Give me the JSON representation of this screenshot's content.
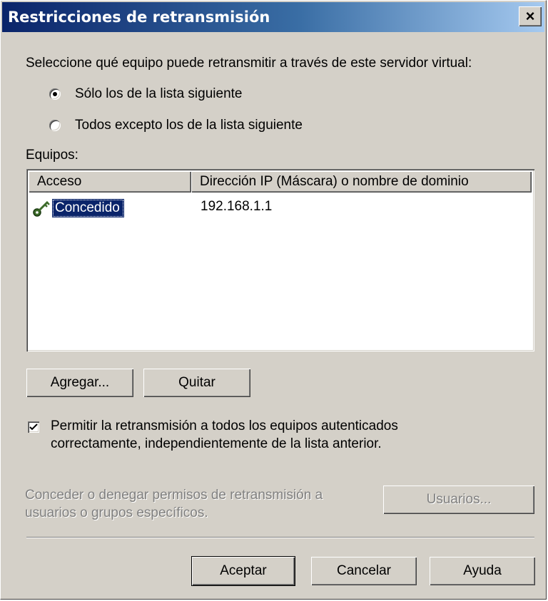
{
  "window": {
    "title": "Restricciones de retransmisión",
    "close_label": "×"
  },
  "intro_text": "Seleccione qué equipo puede retransmitir a través de este servidor virtual:",
  "radio_options": [
    {
      "label": "Sólo los de la lista siguiente",
      "selected": true
    },
    {
      "label": "Todos excepto los de la lista siguiente",
      "selected": false
    }
  ],
  "equipos_label": "Equipos:",
  "table": {
    "columns": [
      "Acceso",
      "Dirección IP (Máscara) o nombre de dominio"
    ],
    "rows": [
      {
        "access": "Concedido",
        "address": "192.168.1.1",
        "icon": "key-icon"
      }
    ]
  },
  "buttons": {
    "add": "Agregar...",
    "remove": "Quitar",
    "users": "Usuarios...",
    "ok": "Aceptar",
    "cancel": "Cancelar",
    "help": "Ayuda"
  },
  "checkbox": {
    "checked": true,
    "line1": "Permitir la retransmisión a todos los equipos autenticados",
    "line2": "correctamente, independientemente de la lista anterior."
  },
  "permissions_text": {
    "line1": "Conceder o denegar permisos de retransmisión a",
    "line2": "usuarios o grupos específicos."
  },
  "colors": {
    "title_start": "#0a246a",
    "title_end": "#a6caf0",
    "dialog_bg": "#d4d0c8",
    "selection": "#0a246a"
  }
}
